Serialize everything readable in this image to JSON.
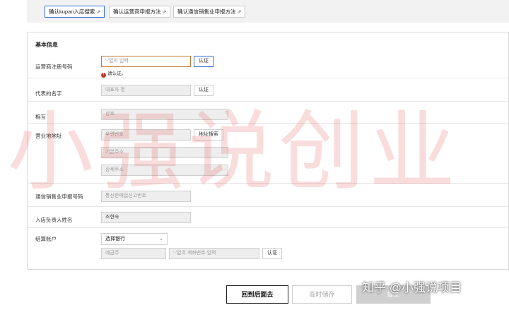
{
  "top_links": [
    {
      "label": "确认kupan入店搜索",
      "active": true
    },
    {
      "label": "确认运营商申报方法",
      "active": false
    },
    {
      "label": "确认通信销售业申报方法",
      "active": false
    }
  ],
  "form": {
    "section_title": "基本信息",
    "business_reg": {
      "label": "运营商注册号码",
      "placeholder": "'-'없이 입력",
      "verify": "认证",
      "error": "请认证。"
    },
    "representative": {
      "label": "代表的名字",
      "placeholder": "대표자 명",
      "verify": "认证"
    },
    "company": {
      "label": "相互",
      "placeholder": "상호"
    },
    "address": {
      "label": "营业地地址",
      "zip_placeholder": "우편번호",
      "search": "地址搜索",
      "basic_placeholder": "기본주소",
      "detail_placeholder": "상세주소"
    },
    "telecom": {
      "label": "通信销售业申报号码",
      "placeholder": "통신판매업신고번호"
    },
    "store_manager": {
      "label": "入店负责人姓名",
      "value": "조현숙"
    },
    "settlement": {
      "label": "结算账户",
      "bank_select": "选择银行",
      "holder_placeholder": "예금주",
      "account_placeholder": "'-'없이 계좌번호 입력",
      "verify": "认证"
    }
  },
  "footer": {
    "back": "回到后面去",
    "temp_save": "临时储存",
    "submit": "提交"
  },
  "watermark": "小强说创业",
  "credit": "知乎 @小强说项目",
  "colors": {
    "accent": "#2f6fd6",
    "error": "#c0392b"
  }
}
